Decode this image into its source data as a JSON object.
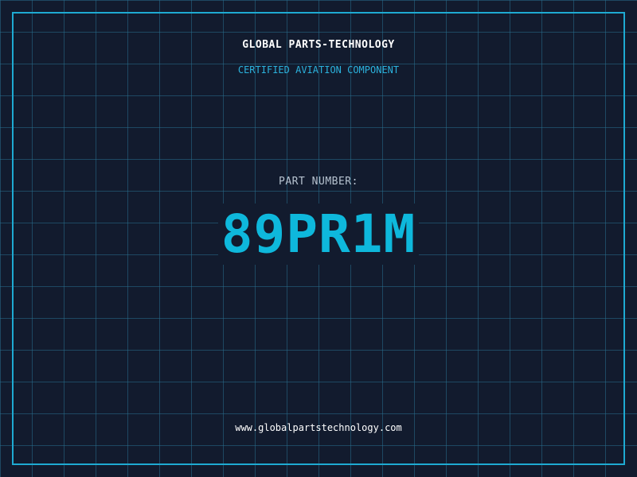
{
  "header": {
    "brand": "GLOBAL PARTS-TECHNOLOGY",
    "subtitle": "CERTIFIED AVIATION COMPONENT"
  },
  "part": {
    "label": "PART NUMBER:",
    "number": "89PR1M"
  },
  "footer": {
    "website": "www.globalpartstechnology.com"
  },
  "colors": {
    "background": "#121b2e",
    "grid": "#286e8c",
    "frame": "#1eaad2",
    "accent": "#0eb8dc",
    "subtitle": "#2bb2dd",
    "label": "#b6c2cf",
    "text": "#ffffff"
  }
}
